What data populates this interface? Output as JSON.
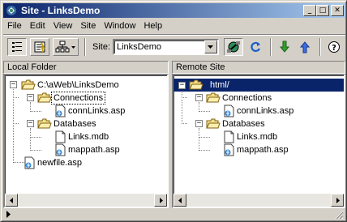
{
  "window": {
    "title": "Site - LinksDemo",
    "minimize_label": "_",
    "maximize_label": "□",
    "close_label": "✕"
  },
  "menu": {
    "items": [
      "File",
      "Edit",
      "View",
      "Site",
      "Window",
      "Help"
    ]
  },
  "toolbar": {
    "site_label": "Site:",
    "site_value": "LinksDemo"
  },
  "local_pane": {
    "header": "Local Folder",
    "nodes": [
      {
        "label": "C:\\aWeb\\LinksDemo",
        "type": "folder-open"
      },
      {
        "label": "Connections",
        "type": "folder-open"
      },
      {
        "label": "connLinks.asp",
        "type": "asp-file"
      },
      {
        "label": "Databases",
        "type": "folder-open"
      },
      {
        "label": "Links.mdb",
        "type": "file"
      },
      {
        "label": "mappath.asp",
        "type": "asp-file"
      },
      {
        "label": "newfile.asp",
        "type": "asp-file"
      }
    ]
  },
  "remote_pane": {
    "header": "Remote Site",
    "nodes": [
      {
        "label": "html/",
        "type": "folder-open"
      },
      {
        "label": "Connections",
        "type": "folder-open"
      },
      {
        "label": "connLinks.asp",
        "type": "asp-file"
      },
      {
        "label": "Databases",
        "type": "folder-open"
      },
      {
        "label": "Links.mdb",
        "type": "file"
      },
      {
        "label": "mappath.asp",
        "type": "asp-file"
      }
    ]
  },
  "colors": {
    "selection": "#0a246a",
    "title_gradient_start": "#0a246a",
    "title_gradient_end": "#a6caf0"
  }
}
